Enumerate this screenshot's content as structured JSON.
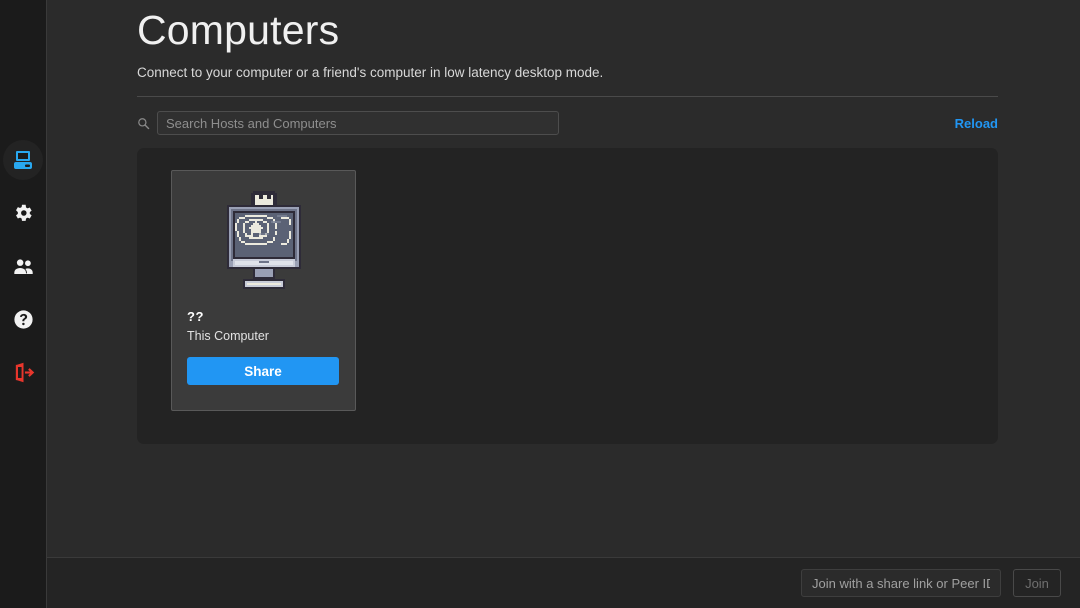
{
  "sidebar": {
    "items": [
      {
        "name": "computers",
        "icon": "computer-icon",
        "active": true
      },
      {
        "name": "settings",
        "icon": "gear-icon",
        "active": false
      },
      {
        "name": "friends",
        "icon": "people-icon",
        "active": false
      },
      {
        "name": "help",
        "icon": "question-circle-icon",
        "active": false
      },
      {
        "name": "logout",
        "icon": "logout-icon",
        "active": false
      }
    ]
  },
  "header": {
    "title": "Computers",
    "subtitle": "Connect to your computer or a friend's computer in low latency desktop mode."
  },
  "toolbar": {
    "search_placeholder": "Search Hosts and Computers",
    "search_value": "",
    "search_icon": "search-icon",
    "reload_label": "Reload"
  },
  "computers": [
    {
      "id": "??",
      "name": "This Computer",
      "art": "pixel-monitor-crown-home",
      "action_label": "Share"
    }
  ],
  "bottom_bar": {
    "join_placeholder": "Join with a share link or Peer ID.",
    "join_value": "",
    "join_label": "Join"
  },
  "colors": {
    "accent": "#2196f3",
    "logout": "#e53935",
    "page_bg": "#2b2b2b",
    "sidebar_bg": "#1b1b1b",
    "panel_bg": "#232323",
    "card_bg": "#3b3b3b"
  }
}
